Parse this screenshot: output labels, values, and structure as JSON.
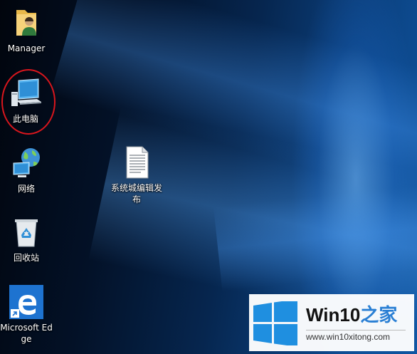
{
  "desktop": {
    "icons": [
      {
        "label": "Manager",
        "icon": "user-folder-icon"
      },
      {
        "label": "此电脑",
        "icon": "this-pc-icon"
      },
      {
        "label": "网络",
        "icon": "network-icon"
      },
      {
        "label": "回收站",
        "icon": "recycle-bin-icon"
      },
      {
        "label": "Microsoft Edge",
        "icon": "edge-icon"
      },
      {
        "label": "系统城编辑发布",
        "icon": "text-file-icon"
      }
    ]
  },
  "watermark": {
    "title_main": "Win10",
    "title_sub": "之家",
    "url": "www.win10xitong.com"
  },
  "colors": {
    "highlight": "#d9161d",
    "accent": "#2a7fd4"
  }
}
